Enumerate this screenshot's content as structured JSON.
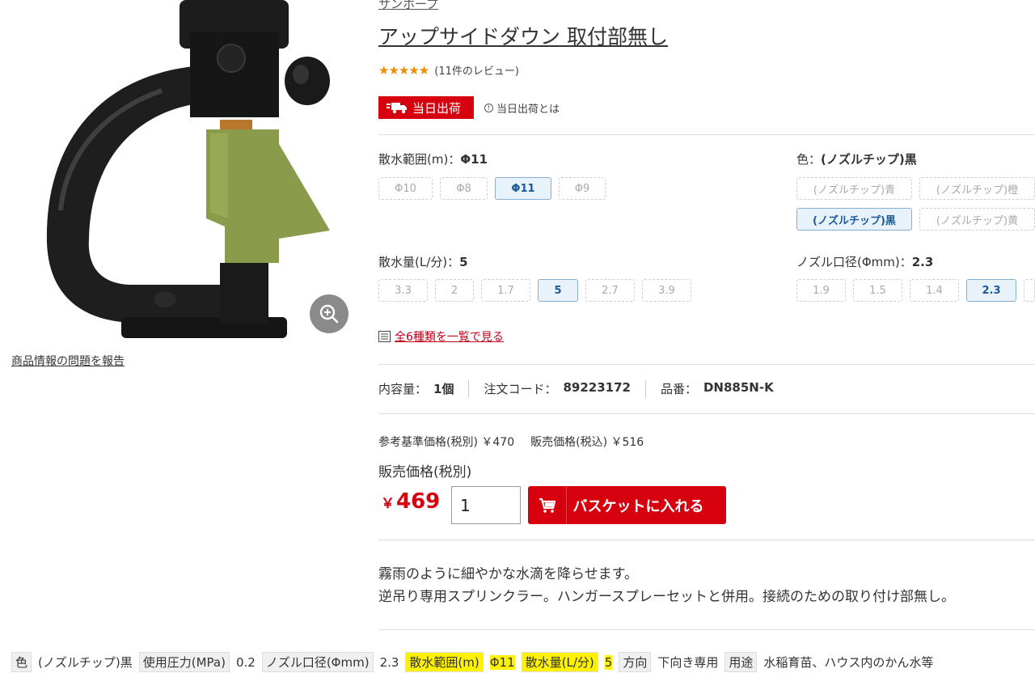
{
  "brand": "サンホープ",
  "title": "アップサイドダウン 取付部無し",
  "rating": {
    "stars": "★★★★★",
    "review_count": "(11件のレビュー)",
    "score": 5
  },
  "sameday": {
    "badge": "当日出荷",
    "info": "当日出荷とは"
  },
  "report_link": "商品情報の問題を報告",
  "options": {
    "range": {
      "label": "散水範囲(m)：",
      "value": "Φ11",
      "chips": [
        "Φ10",
        "Φ8",
        "Φ11",
        "Φ9"
      ]
    },
    "color": {
      "label": "色：",
      "value": "(ノズルチップ)黒",
      "chips": [
        "(ノズルチップ)青",
        "(ノズルチップ)橙",
        "(ノズルチップ)黒",
        "(ノズルチップ)黄"
      ]
    },
    "flow": {
      "label": "散水量(L/分)：",
      "value": "5",
      "chips": [
        "3.3",
        "2",
        "1.7",
        "5",
        "2.7",
        "3.9"
      ]
    },
    "nozzle": {
      "label": "ノズル口径(Φmm)：",
      "value": "2.3",
      "chips": [
        "1.9",
        "1.5",
        "1.4",
        "2.3"
      ]
    }
  },
  "list_link": "全6種類を一覧で見る",
  "specs": {
    "content_label": "内容量：",
    "content_value": "1個",
    "order_label": "注文コード：",
    "order_value": "89223172",
    "part_label": "品番：",
    "part_value": "DN885N-K"
  },
  "ref_price": {
    "ex_tax": "参考基準価格(税別) ￥470",
    "in_tax": "販売価格(税込) ￥516"
  },
  "price_label": "販売価格(税別)",
  "price": {
    "currency": "￥",
    "value": "469"
  },
  "quantity": "1",
  "cart_button": "バスケットに入れる",
  "description": [
    "霧雨のように細やかな水滴を降らせます。",
    "逆吊り専用スプリンクラー。ハンガースプレーセットと併用。接続のための取り付け部無し。"
  ],
  "attributes": [
    {
      "key": "色",
      "value": "(ノズルチップ)黒",
      "highlight": false
    },
    {
      "key": "使用圧力(MPa)",
      "value": "0.2",
      "highlight": false
    },
    {
      "key": "ノズル口径(Φmm)",
      "value": "2.3",
      "highlight": false
    },
    {
      "key": "散水範囲(m)",
      "value": "Φ11",
      "highlight": true
    },
    {
      "key": "散水量(L/分)",
      "value": "5",
      "highlight": true
    },
    {
      "key": "方向",
      "value": "下向き専用",
      "highlight": false
    },
    {
      "key": "用途",
      "value": "水稲育苗、ハウス内のかん水等",
      "highlight": false
    }
  ],
  "colors": {
    "accent_red": "#d7000f",
    "star": "#f08c00",
    "selected_chip_bg": "#e8f2fa",
    "highlight": "#fff200"
  }
}
